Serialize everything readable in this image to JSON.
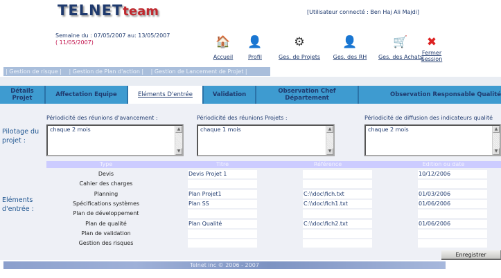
{
  "header": {
    "logo_main": "TELNET",
    "logo_sub": "team",
    "user": "[Utilisateur connecté : Ben Haj Ali Majdi]",
    "week": "Semaine du : 07/05/2007 au: 13/05/2007",
    "today": "( 11/05/2007)"
  },
  "nav": [
    {
      "label": "Accueil",
      "icon": "house-icon"
    },
    {
      "label": "Profil",
      "icon": "user-icon"
    },
    {
      "label": "Ges. de Projets",
      "icon": "gears-icon"
    },
    {
      "label": "Ges. des RH",
      "icon": "person-icon"
    },
    {
      "label": "Ges. des Achats",
      "icon": "cart-icon"
    },
    {
      "label": "Fermer Session",
      "icon": "logout-icon"
    }
  ],
  "subnav": [
    "| Gestion de risque |",
    "| Gestion de Plan d'action |",
    "| Gestion de Lancement de Projet |"
  ],
  "tabs": [
    "Détails Projet",
    "Affectation Equipe",
    "Eléments D'entrée",
    "Validation",
    "Observation Chef Département",
    "Observation Responsable Qualité"
  ],
  "active_tab": "Eléments D'entrée",
  "pilotage": {
    "label": "Pilotage du projet :",
    "fields": [
      {
        "label": "Périodicité des réunions d'avancement :",
        "value": "chaque 2 mois"
      },
      {
        "label": "Périodicité des réunions Projets :",
        "value": "chaque 1 mois"
      },
      {
        "label": "Périodicité de diffusion des indicateurs qualité",
        "value": "chaque 2 mois"
      }
    ]
  },
  "elements": {
    "label": "Eléments d'entrée :",
    "columns": [
      "Type",
      "Titre",
      "Référence",
      "Edition ou date"
    ],
    "rows": [
      {
        "type": "Devis",
        "titre": "Devis Projet 1",
        "ref": "",
        "date": "10/12/2006"
      },
      {
        "type": "Cahier des charges",
        "titre": "",
        "ref": "",
        "date": ""
      },
      {
        "type": "Planning",
        "titre": "Plan Projet1",
        "ref": "C:\\\\doc\\fich.txt",
        "date": "01/03/2006"
      },
      {
        "type": "Spécifications systèmes",
        "titre": "Plan SS",
        "ref": "C:\\\\doc\\fich1.txt",
        "date": "01/06/2006"
      },
      {
        "type": "Plan de développement",
        "titre": "",
        "ref": "",
        "date": ""
      },
      {
        "type": "Plan de qualité",
        "titre": "Plan Qualité",
        "ref": "C:\\\\doc\\fich2.txt",
        "date": "01/06/2006"
      },
      {
        "type": "Plan de validation",
        "titre": "",
        "ref": "",
        "date": ""
      },
      {
        "type": "Gestion des risques",
        "titre": "",
        "ref": "",
        "date": ""
      }
    ]
  },
  "save_label": "Enregistrer",
  "footer": "Telnet inc © 2006 - 2007"
}
